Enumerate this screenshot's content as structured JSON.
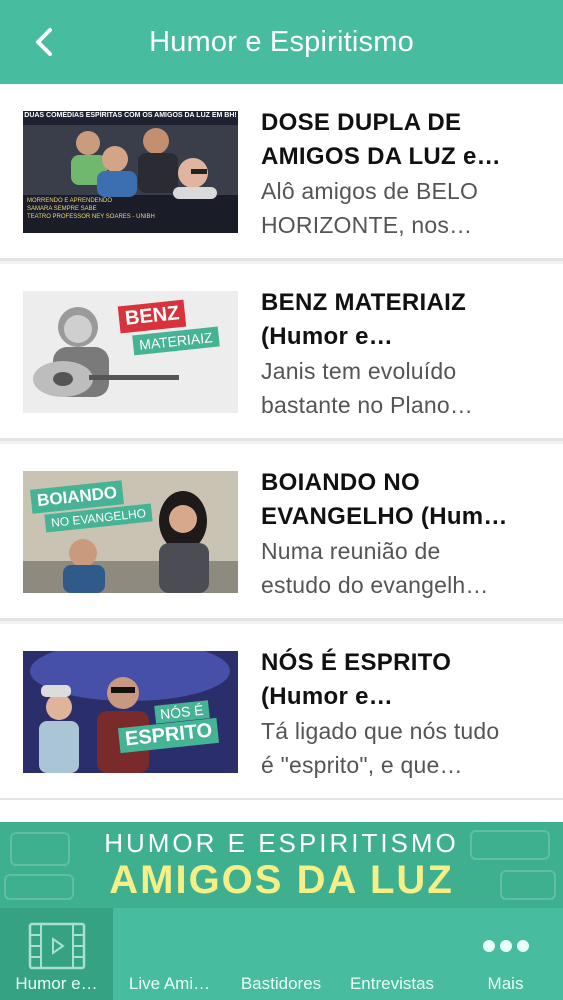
{
  "header": {
    "title": "Humor e Espiritismo",
    "back_icon": "chevron-left-icon"
  },
  "colors": {
    "header_bg": "#48bc9e",
    "tab_active_bg": "#35a283",
    "banner_bg": "#3fb08f",
    "banner_accent": "#f4ef86"
  },
  "items": [
    {
      "title": "DOSE DUPLA DE\nAMIGOS DA LUZ e…",
      "description": "Alô amigos de BELO\nHORIZONTE, nos…",
      "thumb_caption": "DUAS COMÉDIAS ESPÍRITAS COM OS AMIGOS DA LUZ EM BH!",
      "thumb_lines": [
        "MORRENDO E APRENDENDO",
        "SAMARA SEMPRE SABE",
        "TEATRO PROFESSOR NEY SOARES - UNIBH"
      ]
    },
    {
      "title": "BENZ MATERIAIZ\n(Humor e…",
      "description": "Janis tem evoluído\nbastante no Plano…",
      "thumb_tag1": "BENZ",
      "thumb_tag2": "MATERIAIZ"
    },
    {
      "title": "BOIANDO NO\nEVANGELHO (Hum…",
      "description": "Numa reunião de\nestudo do evangelh…",
      "thumb_tag1": "BOIANDO",
      "thumb_tag2": "NO EVANGELHO"
    },
    {
      "title": "NÓS É ESPRITO\n(Humor e…",
      "description": "Tá ligado que nós tudo\né \"esprito\", e que…",
      "thumb_tag1": "NÓS É",
      "thumb_tag2": "ESPRITO"
    }
  ],
  "banner": {
    "line1": "HUMOR E ESPIRITISMO",
    "line2": "AMIGOS DA LUZ"
  },
  "tabs": [
    {
      "label": "Humor e…",
      "icon": "video-film-icon",
      "active": true
    },
    {
      "label": "Live Ami…",
      "icon": "",
      "active": false
    },
    {
      "label": "Bastidores",
      "icon": "",
      "active": false
    },
    {
      "label": "Entrevistas",
      "icon": "",
      "active": false
    },
    {
      "label": "Mais",
      "icon": "more-dots-icon",
      "active": false
    }
  ]
}
